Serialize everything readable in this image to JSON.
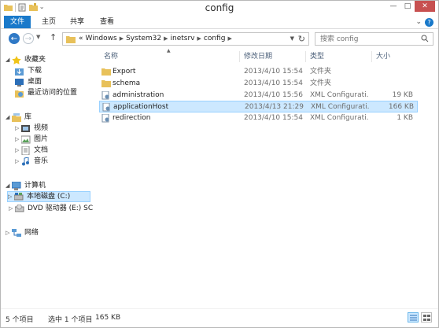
{
  "window": {
    "title": "config"
  },
  "ribbon": {
    "tabs": [
      {
        "label": "文件"
      },
      {
        "label": "主页"
      },
      {
        "label": "共享"
      },
      {
        "label": "查看"
      }
    ],
    "help_label": "?"
  },
  "address": {
    "crumbs": [
      "Windows",
      "System32",
      "inetsrv",
      "config"
    ],
    "overflow": "«"
  },
  "search": {
    "placeholder": "搜索 config"
  },
  "nav": {
    "favorites": {
      "label": "收藏夹",
      "items": [
        {
          "label": "下载"
        },
        {
          "label": "桌面"
        },
        {
          "label": "最近访问的位置"
        }
      ]
    },
    "libraries": {
      "label": "库",
      "items": [
        {
          "label": "视频"
        },
        {
          "label": "图片"
        },
        {
          "label": "文档"
        },
        {
          "label": "音乐"
        }
      ]
    },
    "computer": {
      "label": "计算机",
      "items": [
        {
          "label": "本地磁盘 (C:)"
        },
        {
          "label": "DVD 驱动器 (E:) SC"
        }
      ]
    },
    "network": {
      "label": "网络"
    }
  },
  "columns": {
    "name": "名称",
    "date": "修改日期",
    "type": "类型",
    "size": "大小"
  },
  "files": [
    {
      "name": "Export",
      "date": "2013/4/10 15:54",
      "type": "文件夹",
      "size": "",
      "icon": "folder"
    },
    {
      "name": "schema",
      "date": "2013/4/10 15:54",
      "type": "文件夹",
      "size": "",
      "icon": "folder"
    },
    {
      "name": "administration",
      "date": "2013/4/10 15:56",
      "type": "XML Configurati...",
      "size": "19 KB",
      "icon": "config-file"
    },
    {
      "name": "applicationHost",
      "date": "2013/4/13 21:29",
      "type": "XML Configurati...",
      "size": "166 KB",
      "icon": "config-file"
    },
    {
      "name": "redirection",
      "date": "2013/4/10 15:54",
      "type": "XML Configurati...",
      "size": "1 KB",
      "icon": "config-file"
    }
  ],
  "selected_index": 3,
  "status": {
    "count": "5 个项目",
    "selection": "选中 1 个项目",
    "size": "165 KB"
  },
  "colors": {
    "accent": "#1979ca",
    "selection": "#cce8ff",
    "selection_border": "#99d1ff",
    "folder": "#e8c15a"
  }
}
